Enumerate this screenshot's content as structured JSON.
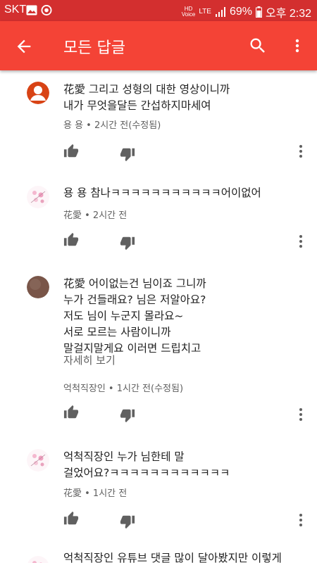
{
  "status_bar": {
    "carrier": "SKT",
    "icons": [
      "image-icon",
      "recording-icon"
    ],
    "hd_voice_top": "HD",
    "hd_voice_bottom": "Voice",
    "network": "LTE",
    "battery": "69%",
    "time": "오후 2:32"
  },
  "app_bar": {
    "title": "모든 답글",
    "back_icon": "arrow-left-icon",
    "search_icon": "search-icon",
    "more_icon": "more-vert-icon"
  },
  "colors": {
    "status_bar": "#d32f2f",
    "app_bar": "#f44336",
    "text_primary": "#212121",
    "text_secondary": "#606060",
    "avatar_red": "#d84315",
    "avatar_brown": "#795548"
  },
  "comments": [
    {
      "avatar": "red-person",
      "text": "花愛 그리고 성형의 대한 영상이니까\n내가 무엇을달든 간섭하지마세여",
      "meta": "용 용 • 2시간 전(수정됨)"
    },
    {
      "avatar": "sakura",
      "text": "용 용 참나ㅋㅋㅋㅋㅋㅋㅋㅋㅋㅋㅋ어이없어",
      "meta": "花愛 • 2시간 전"
    },
    {
      "avatar": "brown",
      "text": "花愛 어이없는건 님이죠 그니까\n누가 건들래요? 님은 저알아요?\n저도 님이 누군지 몰라요~\n서로 모르는 사람이니까\n말걸지말게요  이러면 드립치고",
      "read_more": "자세히 보기",
      "meta": "억척직장인 • 1시간 전(수정됨)"
    },
    {
      "avatar": "sakura",
      "text": "억척직장인 누가 님한테 말\n걸었어요?ㅋㅋㅋㅋㅋㅋㅋㅋㅋㅋㅋㅋ",
      "meta": "花愛 • 1시간 전"
    },
    {
      "avatar": "sakura",
      "text": "억척직장인 유튜브 댓글 많이 달아봤지만 이렇게"
    }
  ]
}
